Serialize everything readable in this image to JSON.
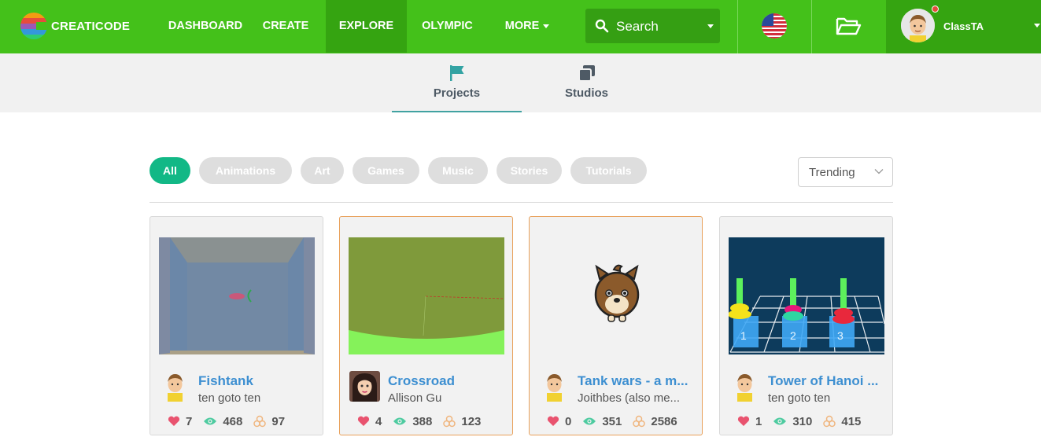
{
  "brand": {
    "name": "CREATICODE"
  },
  "nav": {
    "dashboard": "DASHBOARD",
    "create": "CREATE",
    "explore": "EXPLORE",
    "olympic": "OLYMPIC",
    "more": "MORE"
  },
  "search": {
    "placeholder": "Search"
  },
  "user": {
    "name": "ClassTA"
  },
  "subnav": {
    "projects": "Projects",
    "studios": "Studios"
  },
  "filters": [
    "All",
    "Animations",
    "Art",
    "Games",
    "Music",
    "Stories",
    "Tutorials"
  ],
  "active_filter": "All",
  "sort": {
    "selected": "Trending"
  },
  "colors": {
    "nav_green": "#44c11a",
    "nav_active": "#35a411",
    "accent_teal": "#12b886",
    "link_blue": "#3d8fd1",
    "card_highlight": "#e8a05a"
  },
  "projects": [
    {
      "title": "Fishtank",
      "author": "ten goto ten",
      "likes": "7",
      "views": "468",
      "remixes": "97"
    },
    {
      "title": "Crossroad",
      "author": "Allison Gu",
      "likes": "4",
      "views": "388",
      "remixes": "123"
    },
    {
      "title": "Tank wars - a m...",
      "author": "Joithbes (also me...",
      "likes": "0",
      "views": "351",
      "remixes": "2586"
    },
    {
      "title": "Tower of Hanoi ...",
      "author": "ten goto ten",
      "likes": "1",
      "views": "310",
      "remixes": "415"
    }
  ]
}
